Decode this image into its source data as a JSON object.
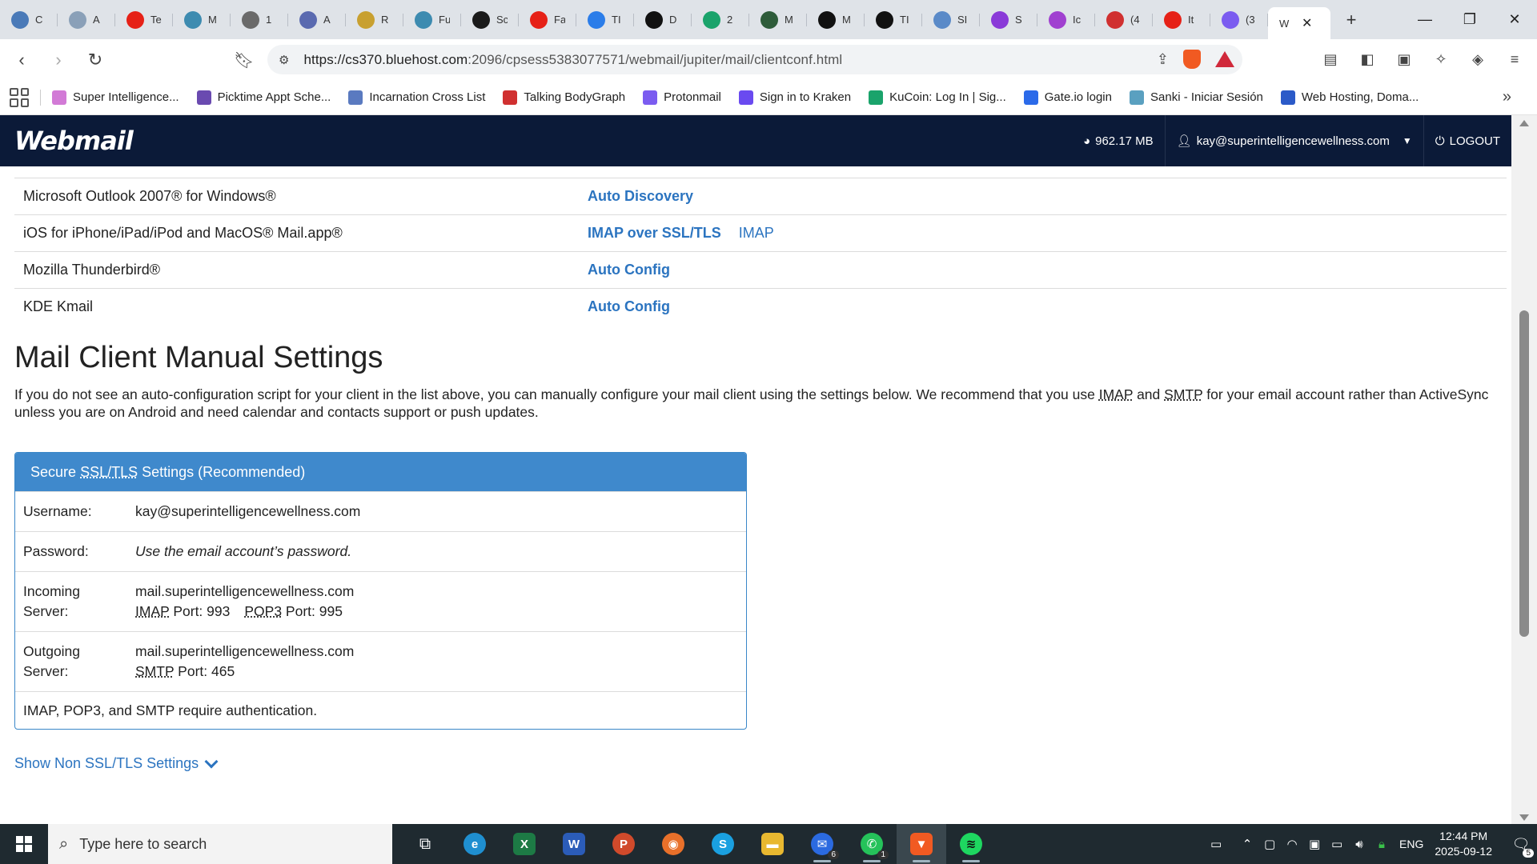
{
  "browser": {
    "tabs": [
      {
        "label": "C",
        "color": "#4a7ab8"
      },
      {
        "label": "A",
        "color": "#8aa0b8"
      },
      {
        "label": "Te",
        "color": "#e62117"
      },
      {
        "label": "M",
        "color": "#3d8bb0"
      },
      {
        "label": "1",
        "color": "#6a6a6a"
      },
      {
        "label": "A",
        "color": "#5a6ab0"
      },
      {
        "label": "R",
        "color": "#c8a030"
      },
      {
        "label": "Fu",
        "color": "#3d8bb0"
      },
      {
        "label": "Sc",
        "color": "#1a1a1a"
      },
      {
        "label": "Fa",
        "color": "#e62117"
      },
      {
        "label": "TI",
        "color": "#2b7de9"
      },
      {
        "label": "D",
        "color": "#111111"
      },
      {
        "label": "2",
        "color": "#1aa36b"
      },
      {
        "label": "M",
        "color": "#2e5c3a"
      },
      {
        "label": "M",
        "color": "#111111"
      },
      {
        "label": "TI",
        "color": "#111111"
      },
      {
        "label": "SI",
        "color": "#5a8ac8"
      },
      {
        "label": "S",
        "color": "#8a3ad8"
      },
      {
        "label": "Ic",
        "color": "#a040d0"
      },
      {
        "label": "(4",
        "color": "#d03030"
      },
      {
        "label": "It",
        "color": "#e62117"
      },
      {
        "label": "(3",
        "color": "#7b5cf0"
      }
    ],
    "active_tab": {
      "label": "W",
      "close": "✕"
    },
    "new_tab": "+",
    "window_controls": {
      "minimize": "—",
      "restore": "❐",
      "close": "✕"
    },
    "url_host": "https://cs370.bluehost.com",
    "url_path": ":2096/cpsess5383077571/webmail/jupiter/mail/clientconf.html",
    "bookmarks": [
      {
        "label": "Super Intelligence...",
        "color": "#d27ad6"
      },
      {
        "label": "Picktime Appt Sche...",
        "color": "#6a4ab0"
      },
      {
        "label": "Incarnation Cross List",
        "color": "#5a7ac0"
      },
      {
        "label": "Talking BodyGraph",
        "color": "#d03030"
      },
      {
        "label": "Protonmail",
        "color": "#7b5cf0"
      },
      {
        "label": "Sign in to Kraken",
        "color": "#6a4af0"
      },
      {
        "label": "KuCoin: Log In | Sig...",
        "color": "#1aa36b"
      },
      {
        "label": "Gate.io login",
        "color": "#2b6ae9"
      },
      {
        "label": "Sanki - Iniciar Sesión",
        "color": "#5aa0c0"
      },
      {
        "label": "Web Hosting, Doma...",
        "color": "#2b5ac8"
      }
    ],
    "bookmarks_more": "»"
  },
  "webmail": {
    "logo": "Webmail",
    "disk_usage": "962.17 MB",
    "account": "kay@superintelligencewellness.com",
    "logout": "LOGOUT"
  },
  "clients": [
    {
      "name": "Microsoft Outlook 2007® for Windows®",
      "links": [
        {
          "label": "Auto Discovery",
          "bold": true
        }
      ]
    },
    {
      "name": "iOS for iPhone/iPad/iPod and MacOS® Mail.app®",
      "links": [
        {
          "label": "IMAP over SSL/TLS",
          "bold": true
        },
        {
          "label": "IMAP",
          "bold": false
        }
      ]
    },
    {
      "name": "Mozilla Thunderbird®",
      "links": [
        {
          "label": "Auto Config",
          "bold": true
        }
      ]
    },
    {
      "name": "KDE Kmail",
      "links": [
        {
          "label": "Auto Config",
          "bold": true
        }
      ]
    }
  ],
  "manual": {
    "title": "Mail Client Manual Settings",
    "intro_1": "If you do not see an auto-configuration script for your client in the list above, you can manually configure your mail client using the settings below. We recommend that you use ",
    "intro_imap": "IMAP",
    "intro_and": " and ",
    "intro_smtp": "SMTP",
    "intro_2": " for your email account rather than ActiveSync unless you are on Android and need calendar and contacts support or push updates."
  },
  "ssl": {
    "heading_pre": "Secure ",
    "heading_abbr": "SSL/TLS",
    "heading_post": " Settings (Recommended)",
    "username_label": "Username:",
    "username_value": "kay@superintelligencewellness.com",
    "password_label": "Password:",
    "password_value": "Use the email account’s password.",
    "incoming_label": "Incoming Server:",
    "incoming_host": "mail.superintelligencewellness.com",
    "imap_abbr": "IMAP",
    "imap_port": " Port: 993",
    "pop3_abbr": "POP3",
    "pop3_port": " Port: 995",
    "outgoing_label": "Outgoing Server:",
    "outgoing_host": "mail.superintelligencewellness.com",
    "smtp_abbr": "SMTP",
    "smtp_port": " Port: 465",
    "auth_note": "IMAP, POP3, and SMTP require authentication."
  },
  "show_non_ssl": "Show Non SSL/TLS Settings",
  "taskbar": {
    "search_placeholder": "Type here to search",
    "lang": "ENG",
    "time": "12:44 PM",
    "date": "2025-09-12",
    "notifications": "5",
    "badges": {
      "mail": "6",
      "whatsapp": "1"
    }
  }
}
